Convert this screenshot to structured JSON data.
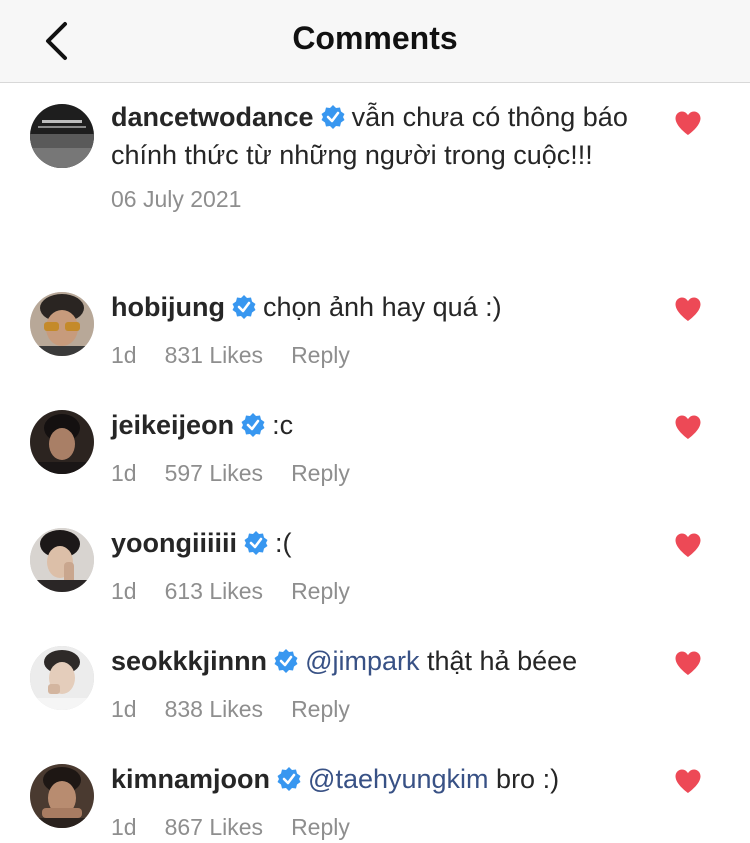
{
  "header": {
    "title": "Comments"
  },
  "caption": {
    "username": "dancetwodance",
    "text": "vẫn chưa có thông báo chính thức từ những người trong cuộc!!!",
    "date": "06 July 2021"
  },
  "comments": [
    {
      "username": "hobijung",
      "mention": "",
      "text": "chọn ảnh hay quá :)",
      "age": "1d",
      "likes": "831 Likes",
      "reply": "Reply"
    },
    {
      "username": "jeikeijeon",
      "mention": "",
      "text": ":c",
      "age": "1d",
      "likes": "597 Likes",
      "reply": "Reply"
    },
    {
      "username": "yoongiiiiii",
      "mention": "",
      "text": ":(",
      "age": "1d",
      "likes": "613 Likes",
      "reply": "Reply"
    },
    {
      "username": "seokkkjinnn",
      "mention": "@jimpark",
      "text": "thật hả béee",
      "age": "1d",
      "likes": "838 Likes",
      "reply": "Reply"
    },
    {
      "username": "kimnamjoon",
      "mention": "@taehyungkim",
      "text": "bro :)",
      "age": "1d",
      "likes": "867 Likes",
      "reply": "Reply"
    }
  ],
  "colors": {
    "heart": "#ed4956",
    "verified": "#3897f0",
    "mention": "#385185",
    "meta": "#8e8e8e"
  },
  "icons": {
    "back": "chevron-left-icon",
    "verified": "verified-badge-icon",
    "like": "heart-filled-icon"
  }
}
